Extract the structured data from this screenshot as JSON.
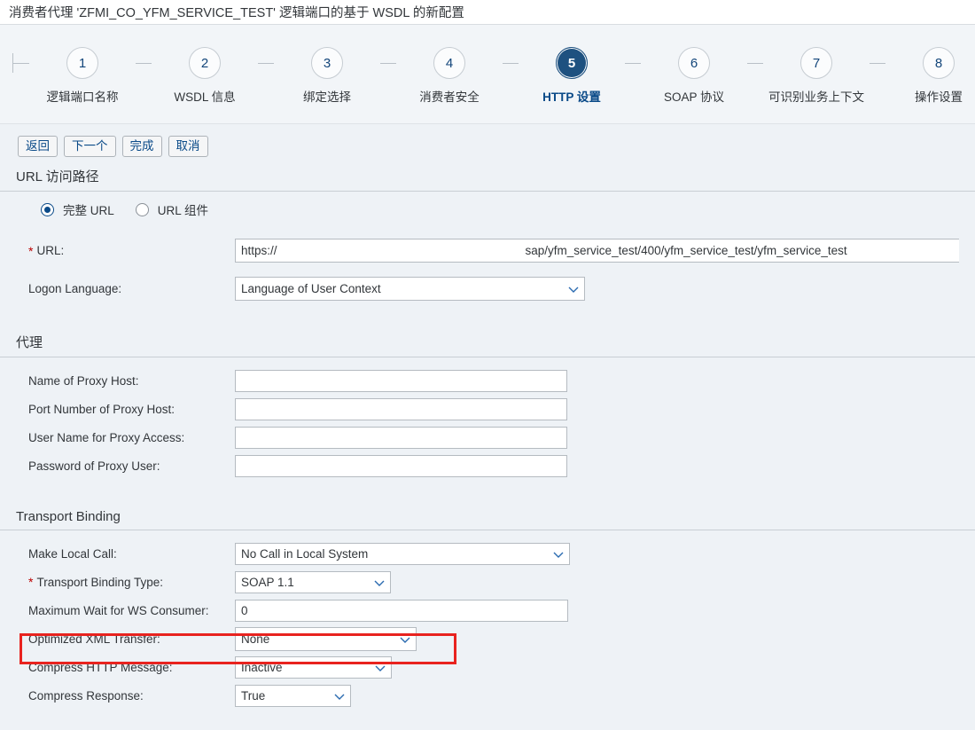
{
  "window": {
    "title": "消费者代理 'ZFMI_CO_YFM_SERVICE_TEST' 逻辑端口的基于 WSDL 的新配置"
  },
  "roadmap": {
    "steps": [
      {
        "number": "1",
        "label": "逻辑端口名称",
        "active": false
      },
      {
        "number": "2",
        "label": "WSDL 信息",
        "active": false
      },
      {
        "number": "3",
        "label": "绑定选择",
        "active": false
      },
      {
        "number": "4",
        "label": "消费者安全",
        "active": false
      },
      {
        "number": "5",
        "label": "HTTP 设置",
        "active": true
      },
      {
        "number": "6",
        "label": "SOAP 协议",
        "active": false
      },
      {
        "number": "7",
        "label": "可识别业务上下文",
        "active": false
      },
      {
        "number": "8",
        "label": "操作设置",
        "active": false
      }
    ]
  },
  "toolbar": {
    "back_label": "返回",
    "next_label": "下一个",
    "finish_label": "完成",
    "cancel_label": "取消"
  },
  "sections": {
    "url_access": {
      "title": "URL 访问路径",
      "radio": {
        "option_full": "完整 URL",
        "option_components": "URL 组件",
        "selected": "完整 URL"
      },
      "url": {
        "label": "URL:",
        "required": true,
        "protocol": "https://",
        "host": "",
        "path": "sap/yfm_service_test/400/yfm_service_test/yfm_service_test"
      },
      "logon_language": {
        "label": "Logon Language:",
        "value": "Language of User Context"
      }
    },
    "proxy": {
      "title": "代理",
      "fields": [
        {
          "label": "Name of Proxy Host:",
          "value": ""
        },
        {
          "label": "Port Number of Proxy Host:",
          "value": ""
        },
        {
          "label": "User Name for Proxy Access:",
          "value": ""
        },
        {
          "label": "Password of Proxy User:",
          "value": ""
        }
      ]
    },
    "transport_binding": {
      "title": "Transport Binding",
      "make_local_call": {
        "label": "Make Local Call:",
        "value": "No Call in Local System"
      },
      "transport_binding_type": {
        "label": "Transport Binding Type:",
        "value": "SOAP 1.1",
        "required": true
      },
      "maximum_wait": {
        "label": "Maximum Wait for WS Consumer:",
        "value": "0"
      },
      "optimized_xml_transfer": {
        "label": "Optimized XML Transfer:",
        "value": "None",
        "highlighted": true
      },
      "compress_http_message": {
        "label": "Compress HTTP Message:",
        "value": "Inactive"
      },
      "compress_response": {
        "label": "Compress Response:",
        "value": "True"
      }
    }
  },
  "colors": {
    "accent": "#0a4a88",
    "active_step": "#1e5180",
    "highlight": "#e8231f",
    "required": "#bb0000",
    "background": "#eef2f6"
  },
  "icons": {
    "chevron_down": "chevron-down-icon",
    "radio_selected": "radio-selected-icon",
    "radio_unselected": "radio-unselected-icon"
  }
}
